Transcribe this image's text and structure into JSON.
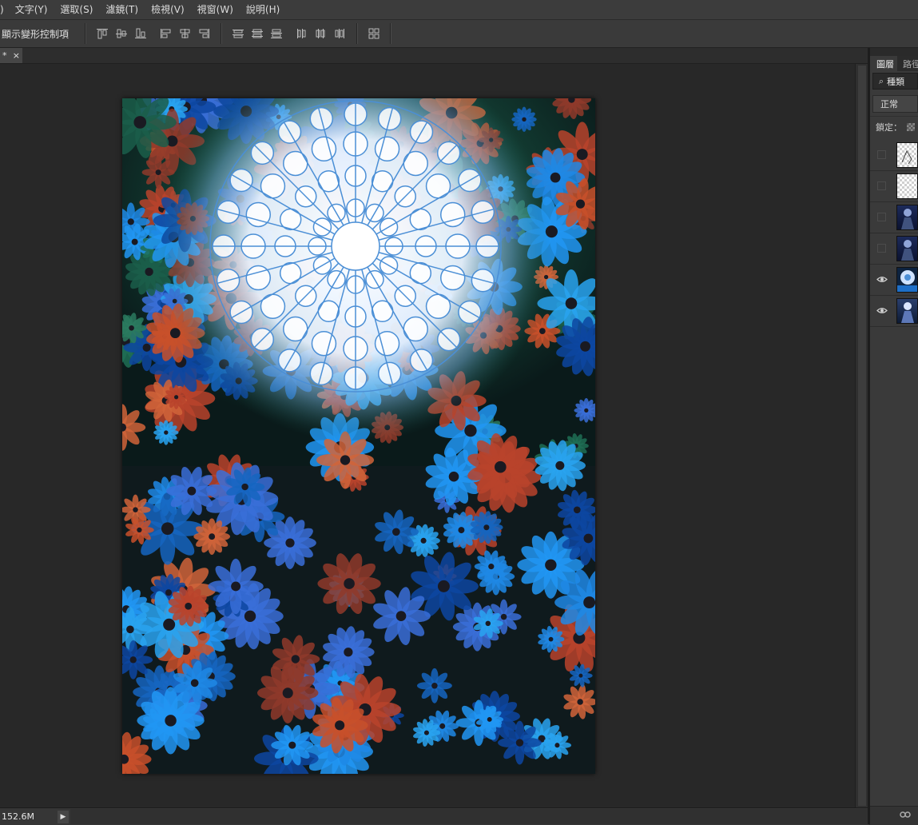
{
  "menu": {
    "items": [
      ")",
      "文字(Y)",
      "選取(S)",
      "濾鏡(T)",
      "檢視(V)",
      "視窗(W)",
      "說明(H)"
    ]
  },
  "options": {
    "show_transform_controls": "顯示變形控制項",
    "align_icons": [
      "align-top-edges-icon",
      "align-vertical-centers-icon",
      "align-bottom-edges-icon",
      "align-left-edges-icon",
      "align-horizontal-centers-icon",
      "align-right-edges-icon"
    ],
    "distribute_icons": [
      "distribute-top-icon",
      "distribute-vertical-centers-icon",
      "distribute-bottom-icon",
      "distribute-left-icon",
      "distribute-horizontal-centers-icon",
      "distribute-right-icon"
    ],
    "auto_align_icon": "auto-align-layers-icon"
  },
  "document": {
    "tab_label": "*",
    "close_glyph": "×"
  },
  "status": {
    "doc_size": "152.6M",
    "arrow_glyph": "▶"
  },
  "layers_panel": {
    "tabs": [
      "圖層",
      "路徑"
    ],
    "filter_glyph": "⌕",
    "filter_label": "種類",
    "blend_mode": "正常",
    "lock_label": "鎖定：",
    "layers": [
      {
        "visible": false,
        "thumb": "transparent-sketch"
      },
      {
        "visible": false,
        "thumb": "transparent"
      },
      {
        "visible": false,
        "thumb": "figure-dark"
      },
      {
        "visible": false,
        "thumb": "figure-dark"
      },
      {
        "visible": true,
        "thumb": "rose-window"
      },
      {
        "visible": true,
        "thumb": "figure-blue"
      }
    ]
  },
  "colors": {
    "accent_blue": "#1e88e5",
    "flower_orange": "#c8502a",
    "window_white": "#f4f8ff"
  }
}
